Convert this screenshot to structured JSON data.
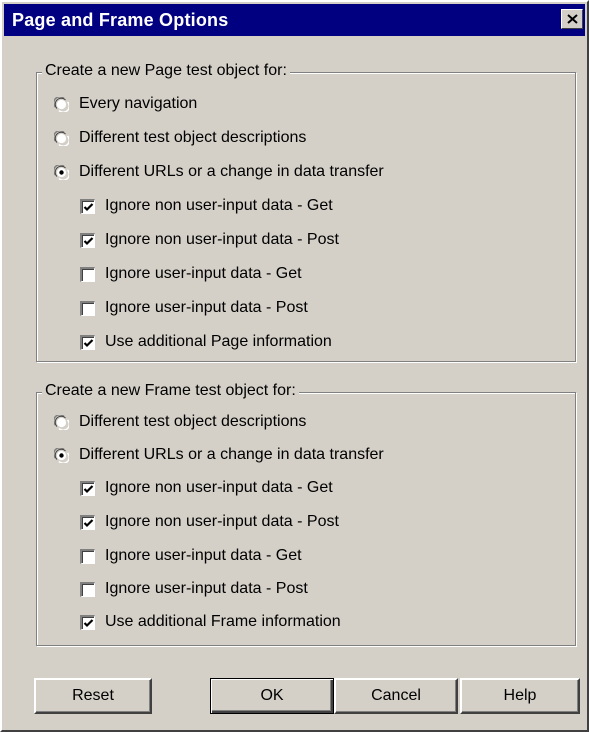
{
  "title": "Page and Frame Options",
  "page_group": {
    "legend": "Create a new Page test object for:",
    "radios": [
      {
        "label": "Every navigation",
        "selected": false
      },
      {
        "label": "Different test object descriptions",
        "selected": false
      },
      {
        "label": "Different URLs or a change in data transfer",
        "selected": true
      }
    ],
    "checkboxes": [
      {
        "label": "Ignore non user-input data - Get",
        "checked": true
      },
      {
        "label": "Ignore non user-input data - Post",
        "checked": true
      },
      {
        "label": "Ignore user-input data - Get",
        "checked": false
      },
      {
        "label": "Ignore user-input data - Post",
        "checked": false
      },
      {
        "label": "Use additional Page information",
        "checked": true
      }
    ]
  },
  "frame_group": {
    "legend": "Create a new Frame test object for:",
    "radios": [
      {
        "label": "Different test object descriptions",
        "selected": false
      },
      {
        "label": "Different URLs or a change in data transfer",
        "selected": true
      }
    ],
    "checkboxes": [
      {
        "label": "Ignore non user-input data - Get",
        "checked": true
      },
      {
        "label": "Ignore non user-input data - Post",
        "checked": true
      },
      {
        "label": "Ignore user-input data - Get",
        "checked": false
      },
      {
        "label": "Ignore user-input data - Post",
        "checked": false
      },
      {
        "label": "Use additional Frame information",
        "checked": true
      }
    ]
  },
  "buttons": {
    "reset": "Reset",
    "ok": "OK",
    "cancel": "Cancel",
    "help": "Help"
  }
}
